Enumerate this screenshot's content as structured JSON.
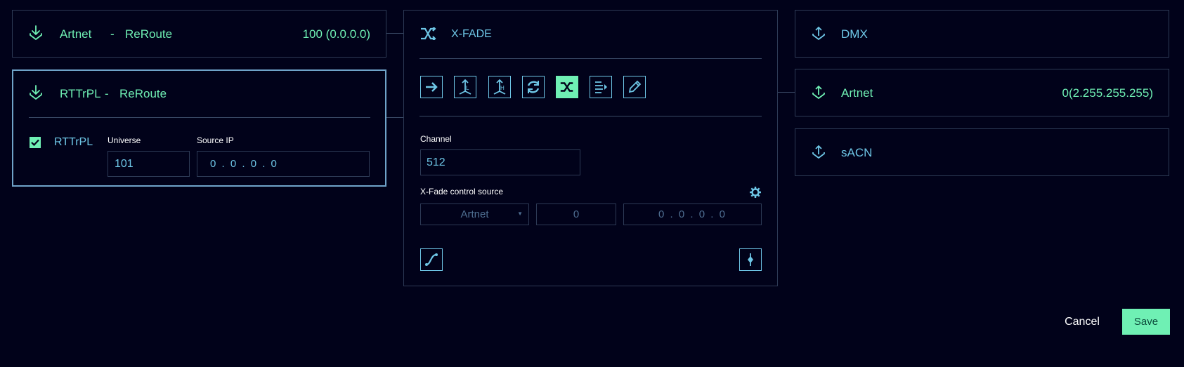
{
  "inputs": [
    {
      "protocol": "Artnet",
      "separator": "-",
      "mode": "ReRoute",
      "value": "100 (0.0.0.0)"
    },
    {
      "protocol": "RTTrPL",
      "separator": "-",
      "mode": "ReRoute",
      "checkbox_label": "RTTrPL",
      "universe_label": "Universe",
      "universe_value": "101",
      "source_ip_label": "Source IP",
      "source_ip_value": "0 . 0 . 0 . 0"
    }
  ],
  "xfade": {
    "title": "X-FADE",
    "tools": [
      "arrow-right-icon",
      "merge-ltp-icon",
      "merge-htp-icon",
      "refresh-icon",
      "shuffle-icon",
      "list-arrow-icon",
      "pencil-icon"
    ],
    "active_tool": "shuffle-icon",
    "channel_label": "Channel",
    "channel_value": "512",
    "control_source_label": "X-Fade control source",
    "control_source_protocol": "Artnet",
    "control_source_universe": "0",
    "control_source_ip": "0 . 0 . 0 . 0"
  },
  "outputs": [
    {
      "protocol": "DMX",
      "value": ""
    },
    {
      "protocol": "Artnet",
      "value": "0(2.255.255.255)"
    },
    {
      "protocol": "sACN",
      "value": ""
    }
  ],
  "actions": {
    "cancel": "Cancel",
    "save": "Save"
  },
  "colors": {
    "background": "#01021a",
    "accent": "#6ff0b4",
    "text_blue": "#6ec6e6",
    "border": "#2d3a55"
  }
}
